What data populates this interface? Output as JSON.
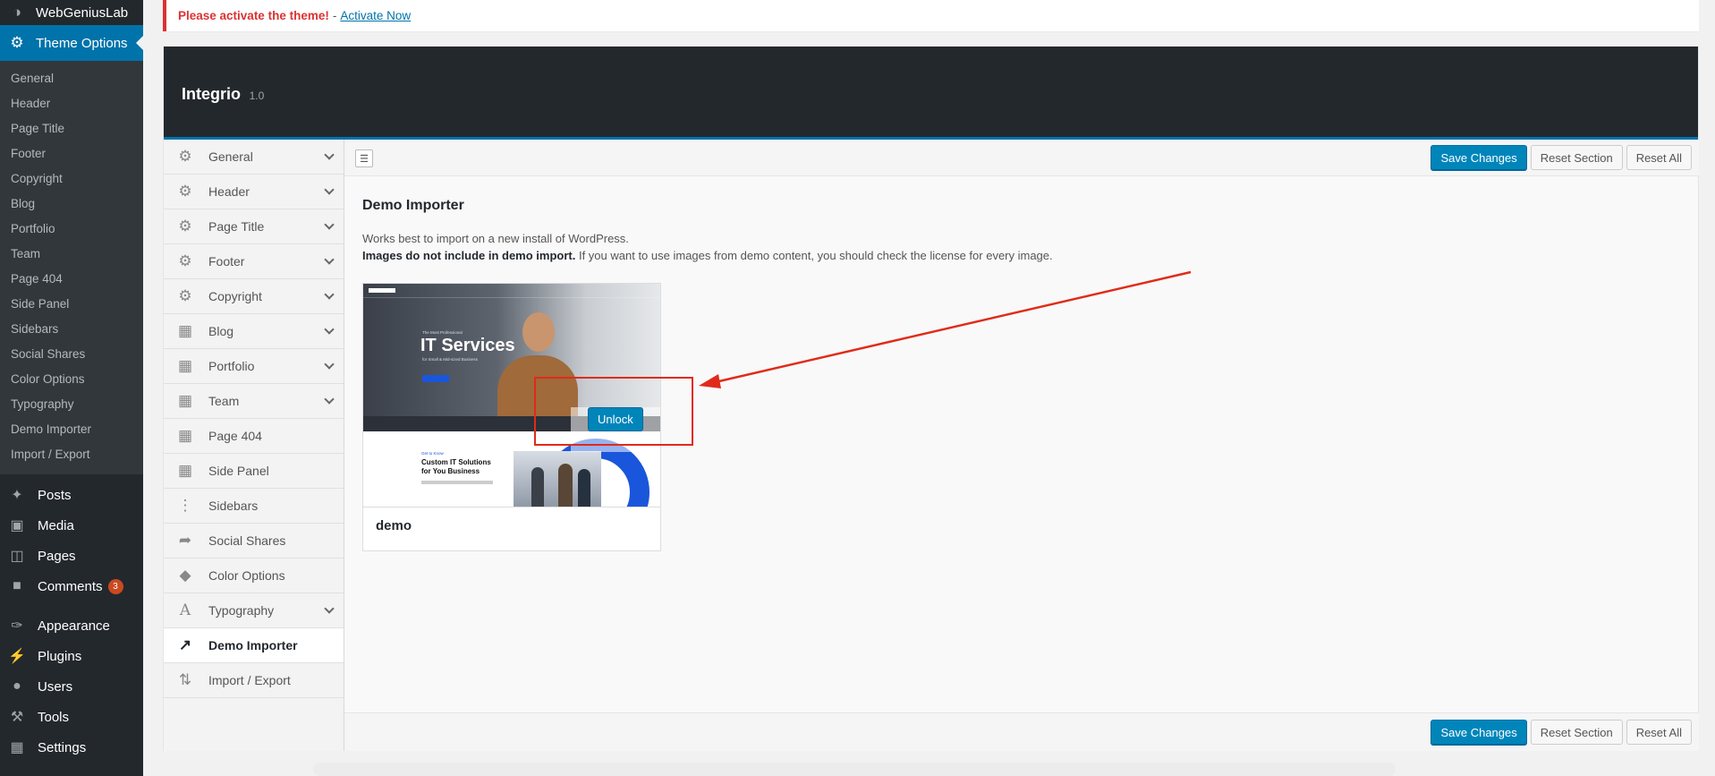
{
  "site": {
    "name": "WebGeniusLab",
    "icon": "wordpress-icon"
  },
  "wp_menu": {
    "current": {
      "label": "Theme Options",
      "icon": "gear-icon"
    },
    "submenu": [
      "General",
      "Header",
      "Page Title",
      "Footer",
      "Copyright",
      "Blog",
      "Portfolio",
      "Team",
      "Page 404",
      "Side Panel",
      "Sidebars",
      "Social Shares",
      "Color Options",
      "Typography",
      "Demo Importer",
      "Import / Export"
    ],
    "items": [
      {
        "label": "Posts",
        "icon": "pin-icon"
      },
      {
        "label": "Media",
        "icon": "media-icon"
      },
      {
        "label": "Pages",
        "icon": "pages-icon"
      },
      {
        "label": "Comments",
        "icon": "comment-icon",
        "badge": "3"
      },
      {
        "label": "Appearance",
        "icon": "brush-icon"
      },
      {
        "label": "Plugins",
        "icon": "plug-icon"
      },
      {
        "label": "Users",
        "icon": "user-icon"
      },
      {
        "label": "Tools",
        "icon": "wrench-icon"
      },
      {
        "label": "Settings",
        "icon": "settings-icon"
      }
    ]
  },
  "notice": {
    "warning": "Please activate the theme!",
    "separator": " - ",
    "link": "Activate Now",
    "color": "#dc3232"
  },
  "panel": {
    "theme_name": "Integrio",
    "version": "1.0"
  },
  "redux_menu": [
    {
      "label": "General",
      "icon": "gear-icon",
      "expandable": true
    },
    {
      "label": "Header",
      "icon": "gear-icon",
      "expandable": true
    },
    {
      "label": "Page Title",
      "icon": "gear-icon",
      "expandable": true
    },
    {
      "label": "Footer",
      "icon": "gear-icon",
      "expandable": true
    },
    {
      "label": "Copyright",
      "icon": "gear-icon",
      "expandable": true
    },
    {
      "label": "Blog",
      "icon": "grid-icon",
      "expandable": true
    },
    {
      "label": "Portfolio",
      "icon": "grid-icon",
      "expandable": true
    },
    {
      "label": "Team",
      "icon": "grid-icon",
      "expandable": true
    },
    {
      "label": "Page 404",
      "icon": "grid-icon",
      "expandable": false
    },
    {
      "label": "Side Panel",
      "icon": "grid-icon",
      "expandable": false
    },
    {
      "label": "Sidebars",
      "icon": "dots-icon",
      "expandable": false
    },
    {
      "label": "Social Shares",
      "icon": "share-icon",
      "expandable": false
    },
    {
      "label": "Color Options",
      "icon": "droplet-icon",
      "expandable": false
    },
    {
      "label": "Typography",
      "icon": "font-icon",
      "expandable": true
    },
    {
      "label": "Demo Importer",
      "icon": "import-icon",
      "expandable": false,
      "active": true
    },
    {
      "label": "Import / Export",
      "icon": "transfer-icon",
      "expandable": false
    }
  ],
  "buttons": {
    "save": "Save Changes",
    "reset_section": "Reset Section",
    "reset_all": "Reset All"
  },
  "section": {
    "title": "Demo Importer",
    "desc_line1": "Works best to import on a new install of WordPress.",
    "desc_bold": "Images do not include in demo import.",
    "desc_rest": " If you want to use images from demo content, you should check the license for every image."
  },
  "demo": {
    "name": "demo",
    "unlock_label": "Unlock",
    "preview": {
      "hero_eyebrow": "The Most Professional",
      "hero_title": "IT Services",
      "hero_sub": "for Small & Mid-sized Business",
      "lower_tag": "Get to Know",
      "lower_title": "Custom IT Solutions for You Business"
    }
  },
  "colors": {
    "accent": "#0073aa",
    "button": "#0085ba",
    "sidebar": "#23282d",
    "annotation": "#e02b1a"
  }
}
